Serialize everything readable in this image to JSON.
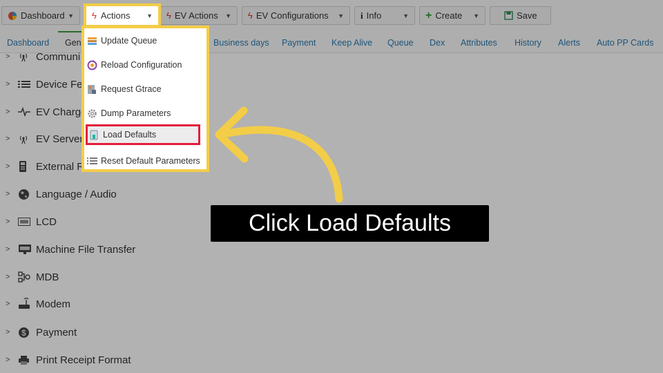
{
  "toolbar": {
    "dashboard_label": "Dashboard",
    "actions_label": "Actions",
    "ev_actions_label": "EV Actions",
    "ev_configurations_label": "EV Configurations",
    "info_label": "Info",
    "create_label": "Create",
    "save_label": "Save"
  },
  "tabs": [
    "Dashboard",
    "Gen",
    "Business days",
    "Payment",
    "Keep Alive",
    "Queue",
    "Dex",
    "Attributes",
    "History",
    "Alerts",
    "Auto PP Cards"
  ],
  "tree": [
    {
      "label": "Communi",
      "icon": "antenna-icon"
    },
    {
      "label": "Device Fe",
      "icon": "list-icon"
    },
    {
      "label": "EV Charge",
      "icon": "pulse-icon"
    },
    {
      "label": "EV Server",
      "icon": "antenna-icon"
    },
    {
      "label": "External R",
      "icon": "device-icon"
    },
    {
      "label": "Language / Audio",
      "icon": "globe-icon"
    },
    {
      "label": "LCD",
      "icon": "lcd-icon"
    },
    {
      "label": "Machine File Transfer",
      "icon": "ftp-icon"
    },
    {
      "label": "MDB",
      "icon": "mdb-icon"
    },
    {
      "label": "Modem",
      "icon": "modem-icon"
    },
    {
      "label": "Payment",
      "icon": "dollar-icon"
    },
    {
      "label": "Print Receipt Format",
      "icon": "printer-icon"
    }
  ],
  "menu": {
    "items": [
      {
        "label": "Update Queue",
        "icon": "queue-icon"
      },
      {
        "label": "Reload Configuration",
        "icon": "reload-icon"
      },
      {
        "label": "Request Gtrace",
        "icon": "gtrace-icon"
      },
      {
        "label": "Dump Parameters",
        "icon": "gear-icon"
      },
      {
        "label": "Load Defaults",
        "icon": "load-icon"
      },
      {
        "label": "Reset Default Parameters",
        "icon": "list-icon"
      }
    ]
  },
  "callout": {
    "text": "Click Load Defaults"
  },
  "colors": {
    "highlight_yellow": "#f3cd48",
    "highlight_red": "#e31c3d",
    "link_blue": "#2a7ab0",
    "tab_active_green": "#3a9a3a"
  }
}
